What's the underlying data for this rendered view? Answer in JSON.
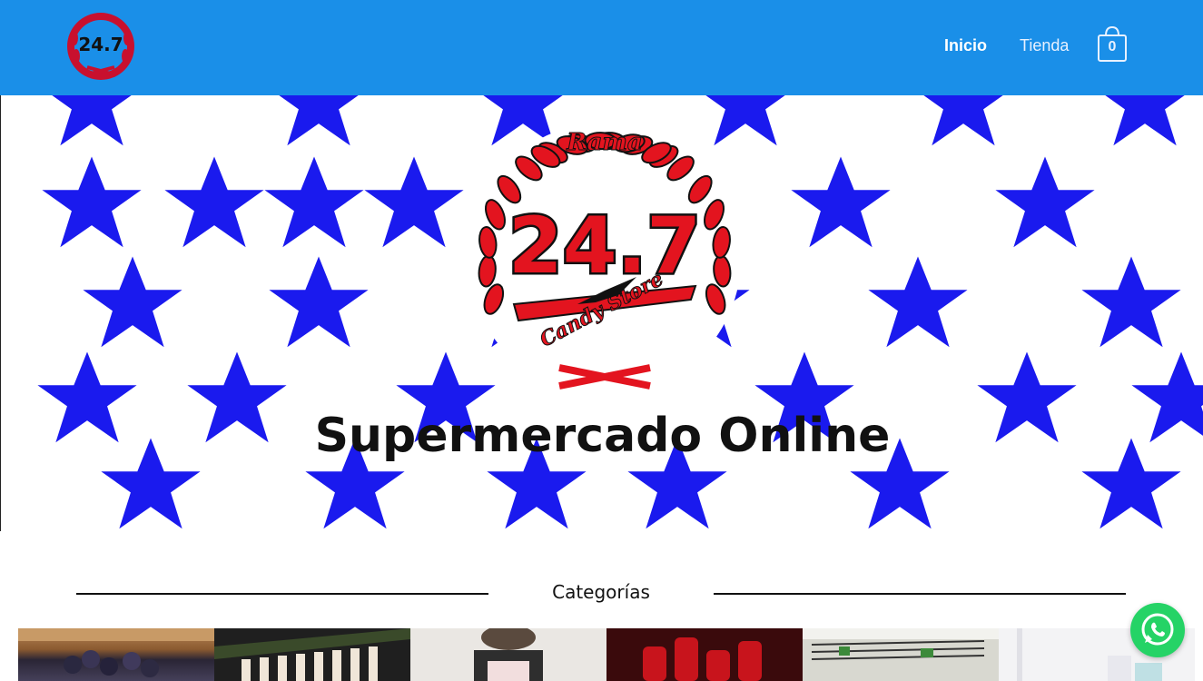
{
  "header": {
    "logo_text": "24.7",
    "nav": [
      {
        "label": "Inicio",
        "active": true
      },
      {
        "label": "Tienda",
        "active": false
      }
    ],
    "cart_count": "0",
    "bg_color": "#1a8fe8"
  },
  "hero": {
    "emblem_top": "Rama",
    "emblem_number": "24.7",
    "emblem_bottom": "Candy Store",
    "title": "Supermercado Online",
    "star_color": "#1a1aee"
  },
  "categories": {
    "title": "Categorías",
    "tiles": [
      {
        "icon": "berries-image"
      },
      {
        "icon": "bottles-shelf-image"
      },
      {
        "icon": "gift-box-image"
      },
      {
        "icon": "soda-bottles-image"
      },
      {
        "icon": "freezer-image"
      },
      {
        "icon": "cleaning-products-image"
      }
    ]
  },
  "whatsapp": {
    "icon": "whatsapp-icon"
  }
}
